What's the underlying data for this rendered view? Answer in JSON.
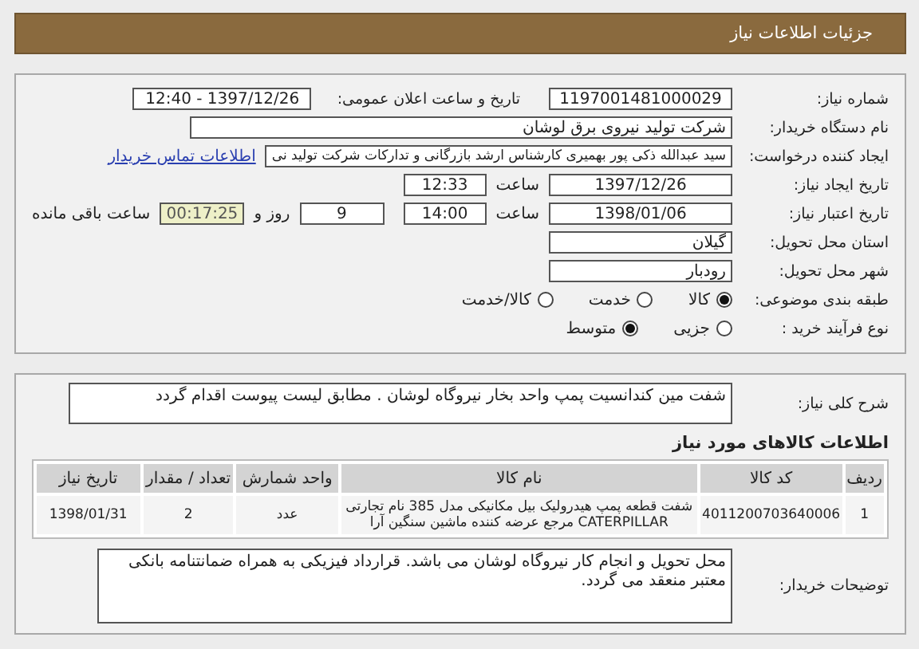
{
  "header": {
    "title": "جزئیات اطلاعات نیاز"
  },
  "fields": [
    {
      "kind": "pair",
      "label": "شماره نیاز:",
      "value": "1197001481000029",
      "label2": "تاریخ و ساعت اعلان عمومی:",
      "value2": "1397/12/26 - 12:40"
    },
    {
      "kind": "wide",
      "label": "نام دستگاه خریدار:",
      "value": "شرکت تولید نیروی برق لوشان"
    },
    {
      "kind": "link",
      "label": "ایجاد کننده درخواست:",
      "value": "سید عبدالله ذکی پور بهمیری کارشناس ارشد بازرگانی و تدارکات شرکت تولید نی",
      "link": "اطلاعات تماس خریدار"
    },
    {
      "kind": "time",
      "label": "تاریخ ایجاد نیاز:",
      "value": "1397/12/26",
      "time_label": "ساعت",
      "time": "12:33"
    },
    {
      "kind": "deadline",
      "label": "تاریخ اعتبار نیاز:",
      "value": "1398/01/06",
      "time_label": "ساعت",
      "time": "14:00",
      "days": "9",
      "days_label": "روز و",
      "remaining": "00:17:25",
      "remaining_label": "ساعت باقی مانده"
    },
    {
      "kind": "single",
      "label": "استان محل تحویل:",
      "value": "گیلان"
    },
    {
      "kind": "single",
      "label": "شهر محل تحویل:",
      "value": "رودبار"
    },
    {
      "kind": "radio",
      "label": "طبقه بندی موضوعی:",
      "options": [
        {
          "label": "کالا",
          "selected": true
        },
        {
          "label": "خدمت",
          "selected": false
        },
        {
          "label": "کالا/خدمت",
          "selected": false
        }
      ]
    },
    {
      "kind": "radio",
      "label": "نوع فرآیند خرید :",
      "options": [
        {
          "label": "جزیی",
          "selected": false
        },
        {
          "label": "متوسط",
          "selected": true
        }
      ]
    }
  ],
  "summary": {
    "label": "شرح کلی نیاز:",
    "value": "شفت مین کندانسیت پمپ واحد بخار نیروگاه لوشان . مطابق لیست پیوست اقدام گردد"
  },
  "goods": {
    "title": "اطلاعات کالاهای مورد نیاز",
    "columns": [
      "ردیف",
      "کد کالا",
      "نام کالا",
      "واحد شمارش",
      "تعداد / مقدار",
      "تاریخ نیاز"
    ],
    "rows": [
      [
        "1",
        "4011200703640006",
        "شفت قطعه پمپ هیدرولیک بیل مکانیکی مدل 385 نام تجارتی CATERPILLAR مرجع عرضه کننده ماشین سنگین آرا",
        "عدد",
        "2",
        "1398/01/31"
      ]
    ]
  },
  "notes": {
    "label": "توضیحات خریدار:",
    "value": "محل تحویل و انجام کار نیروگاه لوشان می باشد. قرارداد فیزیکی به همراه ضمانتنامه بانکی معتبر منعقد می گردد."
  }
}
